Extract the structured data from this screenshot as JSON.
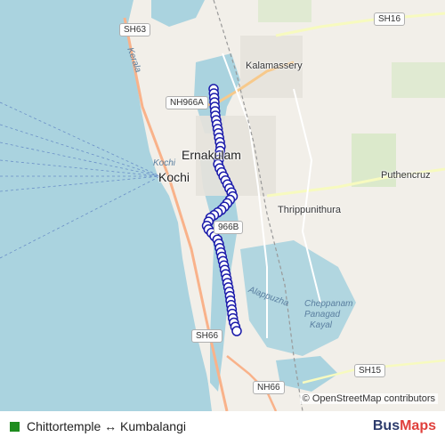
{
  "map": {
    "places": [
      {
        "id": "kalamassery",
        "label": "Kalamassery"
      },
      {
        "id": "ernakulam",
        "label": "Ernakulam"
      },
      {
        "id": "kochi",
        "label": "Kochi"
      },
      {
        "id": "thrippunithura",
        "label": "Thrippunithura"
      },
      {
        "id": "puthencruz",
        "label": "Puthencruz"
      },
      {
        "id": "alappuzha",
        "label": "Alappuzha"
      },
      {
        "id": "chepp",
        "label": "Cheppanam"
      },
      {
        "id": "panagad",
        "label": "Panagad"
      },
      {
        "id": "kayal",
        "label": "Kayal"
      },
      {
        "id": "kerala",
        "label": "Kerala"
      },
      {
        "id": "kochi-water",
        "label": "Kochi"
      }
    ],
    "road_shields": [
      "SH63",
      "SH16",
      "NH966A",
      "966B",
      "SH66",
      "SH15",
      "NH66"
    ],
    "attribution": "© OpenStreetMap contributors",
    "route_color": "#1a1aaa",
    "stop_count_visible": 60
  },
  "legend": {
    "route_name": "Chittortemple ↔ Kumbalangi",
    "swatch_color": "#1e8c1e"
  },
  "brand": {
    "part1": "Bus",
    "part2": "Maps"
  }
}
